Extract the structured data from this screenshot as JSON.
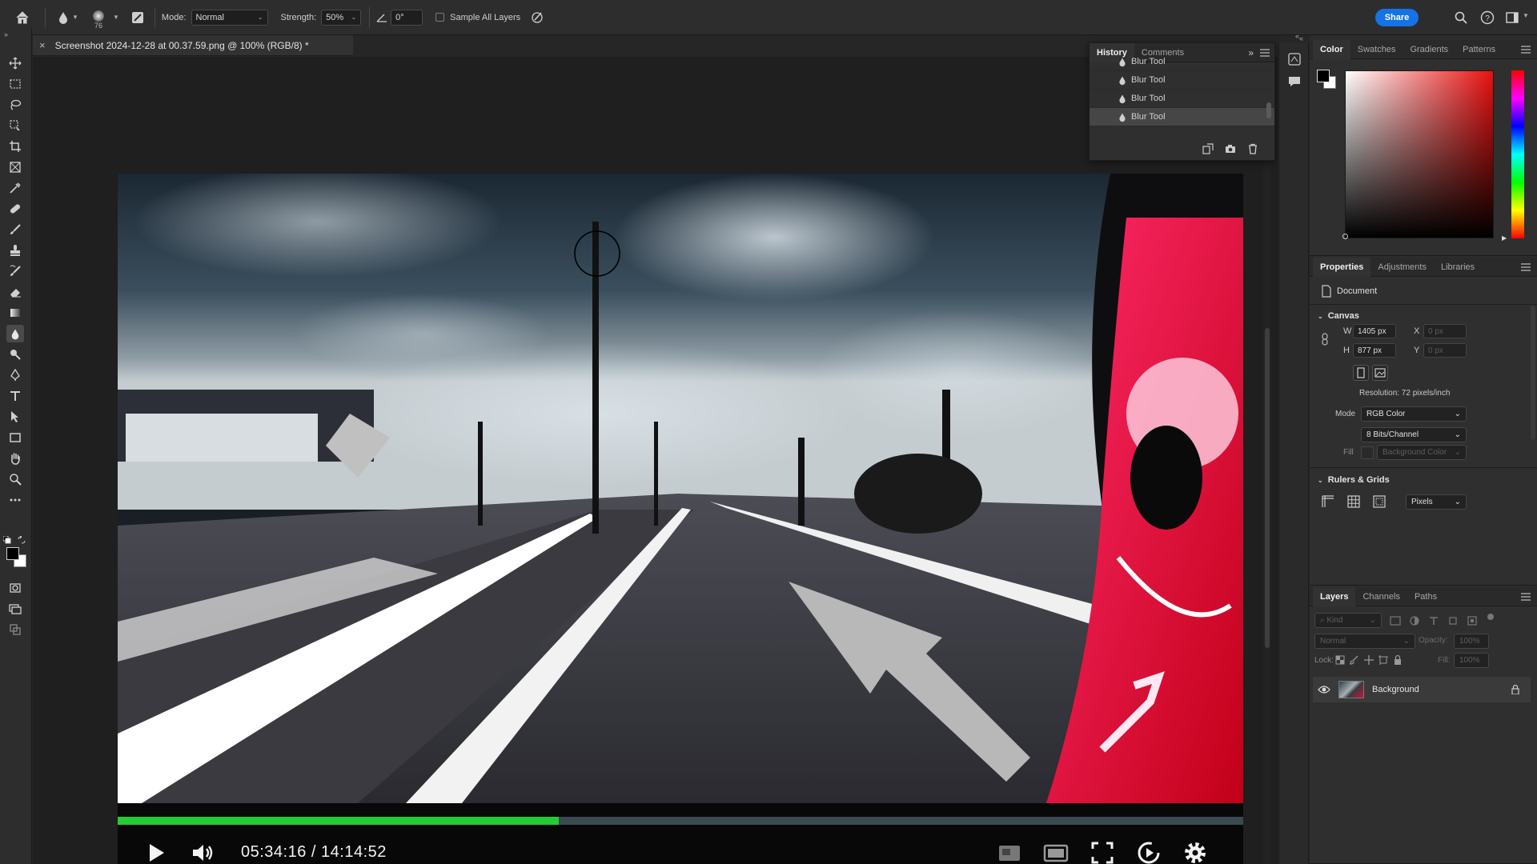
{
  "options_bar": {
    "brush_size": "76",
    "mode_label": "Mode:",
    "mode_value": "Normal",
    "strength_label": "Strength:",
    "strength_value": "50%",
    "angle_value": "0°",
    "sample_all_layers_label": "Sample All Layers",
    "share_label": "Share"
  },
  "document": {
    "tab_title": "Screenshot 2024-12-28 at 00.37.59.png @ 100% (RGB/8) *"
  },
  "video_player": {
    "time_display": "05:34:16 / 14:14:52",
    "progress": 0.392,
    "progress_color": "#22cc33"
  },
  "history": {
    "tabs": [
      "History",
      "Comments"
    ],
    "active_tab": "History",
    "items": [
      "Blur Tool",
      "Blur Tool",
      "Blur Tool",
      "Blur Tool"
    ],
    "selected_index": 3
  },
  "color_panel": {
    "tabs": [
      "Color",
      "Swatches",
      "Gradients",
      "Patterns"
    ],
    "foreground": "#000000",
    "background": "#ffffff"
  },
  "properties": {
    "tabs": [
      "Properties",
      "Adjustments",
      "Libraries"
    ],
    "type_label": "Document",
    "canvas_heading": "Canvas",
    "w_label": "W",
    "w_value": "1405 px",
    "h_label": "H",
    "h_value": "877 px",
    "x_label": "X",
    "x_value": "0 px",
    "y_label": "Y",
    "y_value": "0 px",
    "resolution": "Resolution: 72 pixels/inch",
    "mode_label": "Mode",
    "mode_value": "RGB Color",
    "bits_value": "8 Bits/Channel",
    "fill_label": "Fill",
    "fill_value": "Background Color",
    "rulers_heading": "Rulers & Grids",
    "units_value": "Pixels"
  },
  "layers": {
    "tabs": [
      "Layers",
      "Channels",
      "Paths"
    ],
    "kind_placeholder": "Kind",
    "blend_mode": "Normal",
    "opacity_label": "Opacity:",
    "opacity_value": "100%",
    "lock_label": "Lock:",
    "fill_label": "Fill:",
    "fill_value": "100%",
    "layer_name": "Background"
  },
  "accent_color": "#1473e6"
}
